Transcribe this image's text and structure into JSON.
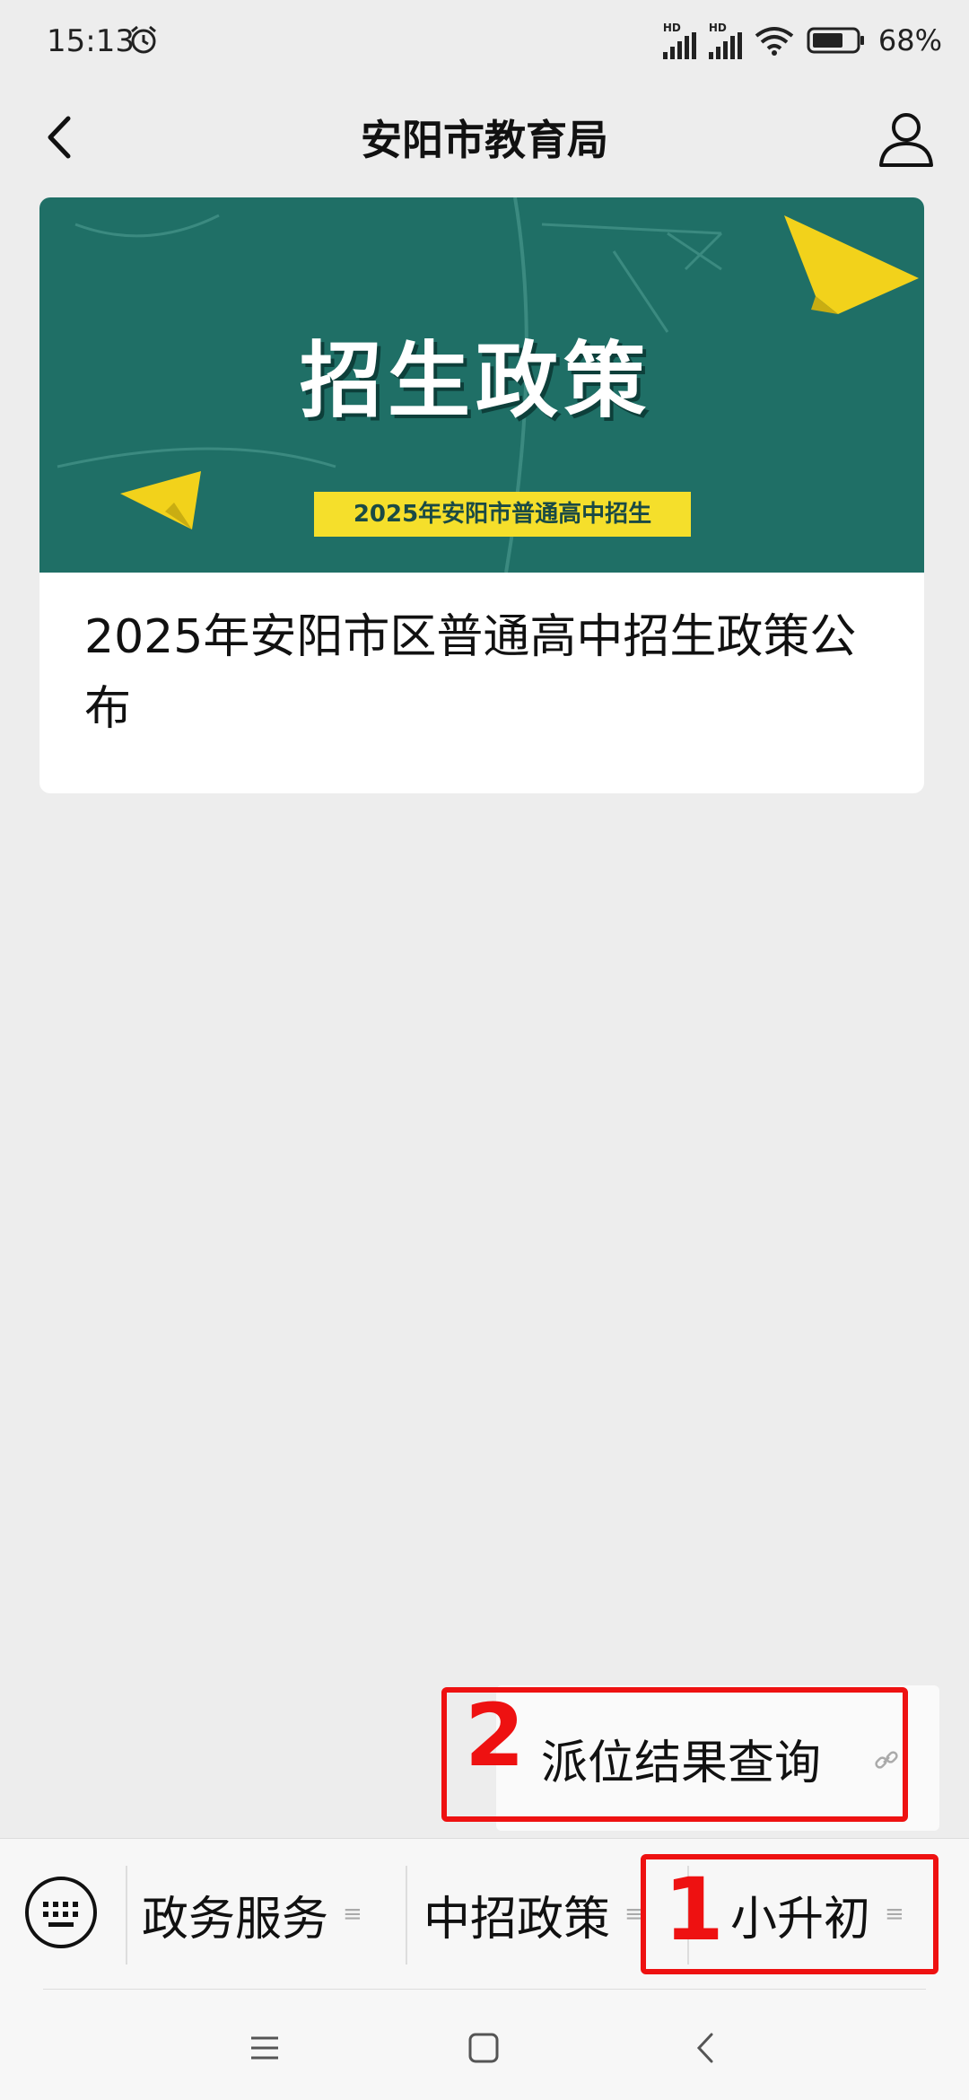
{
  "status_bar": {
    "time": "15:13",
    "hd1": "HD",
    "hd2": "HD",
    "battery": "68%",
    "icons": [
      "alarm-icon",
      "signal-icon",
      "signal-icon",
      "wifi-icon",
      "battery-icon"
    ]
  },
  "header": {
    "title": "安阳市教育局",
    "back_icon": "chevron-left-icon",
    "profile_icon": "person-icon"
  },
  "article": {
    "banner_title": "招生政策",
    "banner_subtitle": "2025年安阳市普通高中招生",
    "text": "2025年安阳市区普通高中招生政策公布"
  },
  "submenu": {
    "item": "派位结果查询",
    "icon": "link-icon"
  },
  "menu": {
    "items": [
      {
        "label": "政务服务",
        "icon": "≡"
      },
      {
        "label": "中招政策",
        "icon": "≡"
      },
      {
        "label": "小升初",
        "icon": "≡"
      }
    ],
    "keyboard_icon": "keyboard-icon"
  },
  "annotations": {
    "marker_1": "1",
    "marker_2": "2",
    "color": "#e11111"
  },
  "colors": {
    "background": "#ededed",
    "banner": "#1f6f66",
    "banner_tag": "#f5df2b"
  }
}
